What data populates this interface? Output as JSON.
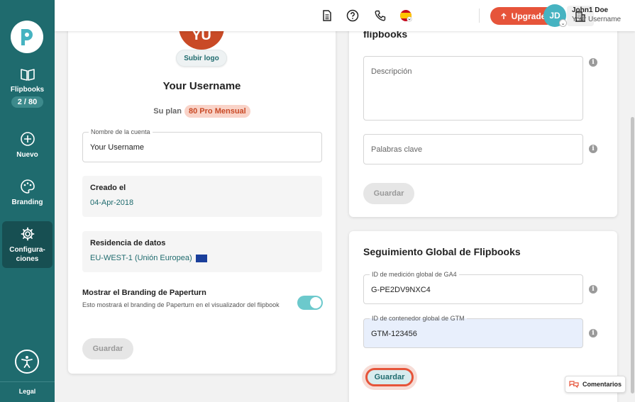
{
  "sidebar": {
    "items": [
      {
        "label": "Flipbooks",
        "count": "2 / 80"
      },
      {
        "label": "Nuevo"
      },
      {
        "label": "Branding"
      },
      {
        "label": "Configura-",
        "label2": "ciones"
      }
    ],
    "legal": "Legal"
  },
  "topbar": {
    "upgrade_label": "Upgrade",
    "user_initials": "JD",
    "user_name": "John1 Doe",
    "user_subtitle": "Your Username"
  },
  "account": {
    "logo_initials": "YU",
    "upload_logo": "Subir logo",
    "title": "Your Username",
    "plan_label": "Su plan",
    "plan_value": "80 Pro Mensual",
    "account_name_label": "Nombre de la cuenta",
    "account_name_value": "Your Username",
    "created_label": "Creado el",
    "created_value": "04-Apr-2018",
    "residency_label": "Residencia de datos",
    "residency_value": "EU-WEST-1 (Unión Europea)",
    "branding_title": "Mostrar el Branding de Paperturn",
    "branding_desc": "Esto mostrará el branding de Paperturn en el visualizador del flipbook",
    "branding_on": true,
    "save_label": "Guardar"
  },
  "seo": {
    "title": "flipbooks",
    "description_placeholder": "Descripción",
    "keywords_placeholder": "Palabras clave",
    "save_label": "Guardar"
  },
  "tracking": {
    "title": "Seguimiento Global de Flipbooks",
    "ga4_label": "ID de medición global de GA4",
    "ga4_value": "G-PE2DV9NXC4",
    "gtm_label": "ID de contenedor global de GTM",
    "gtm_value": "GTM-123456",
    "save_label": "Guardar"
  },
  "comments_label": "Comentarios",
  "colors": {
    "sidebar": "#1f6b6e",
    "accent": "#e6543a",
    "teal": "#46b3c1"
  }
}
